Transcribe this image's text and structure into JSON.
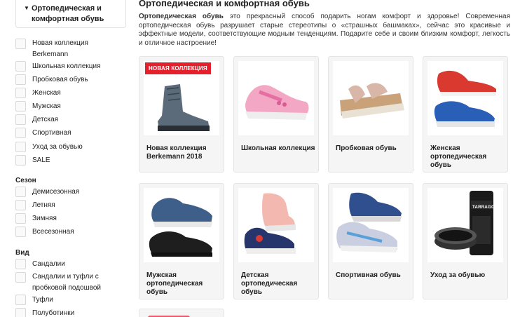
{
  "sidebar": {
    "category": "Ортопедическая и комфортная обувь",
    "filters": [
      {
        "label": "Новая коллекция Berkemann"
      },
      {
        "label": "Школьная коллекция"
      },
      {
        "label": "Пробковая обувь"
      },
      {
        "label": "Женская"
      },
      {
        "label": "Мужская"
      },
      {
        "label": "Детская"
      },
      {
        "label": "Спортивная"
      },
      {
        "label": "Уход за обувью"
      },
      {
        "label": "SALE"
      }
    ],
    "season": {
      "title": "Сезон",
      "items": [
        {
          "label": "Демисезонная"
        },
        {
          "label": "Летняя"
        },
        {
          "label": "Зимняя"
        },
        {
          "label": "Всесезонная"
        }
      ]
    },
    "type": {
      "title": "Вид",
      "items": [
        {
          "label": "Сандалии"
        },
        {
          "label": "Сандалии и туфли с пробковой подошвой"
        },
        {
          "label": "Туфли"
        },
        {
          "label": "Полуботинки"
        }
      ]
    }
  },
  "main": {
    "title": "Ортопедическая и комфортная обувь",
    "intro_bold": "Ортопедическая обувь",
    "intro_rest": " это прекрасный способ подарить ногам комфорт и здоровье! Современная ортопедическая обувь разрушает старые стереотипы о «страшных башмаках», сейчас это красивые и эффектные модели, соответствующие модным тенденциям. Подарите себе и своим близким комфорт, легкость и отличное настроение!",
    "cards": [
      {
        "name": "Новая коллекция Berkemann 2018",
        "badge": "НОВАЯ КОЛЛЕКЦИЯ"
      },
      {
        "name": "Школьная коллекция"
      },
      {
        "name": "Пробковая обувь"
      },
      {
        "name": "Женская ортопедическая обувь"
      },
      {
        "name": "Мужская ортопедическая обувь"
      },
      {
        "name": "Детская ортопедическая обувь"
      },
      {
        "name": "Спортивная обувь"
      },
      {
        "name": "Уход за обувью"
      }
    ],
    "care_brand": "TARRAGO"
  },
  "colors": {
    "badge": "#e3202c",
    "card_bg": "#f5f5f5",
    "card_border": "#e4e4e4"
  }
}
